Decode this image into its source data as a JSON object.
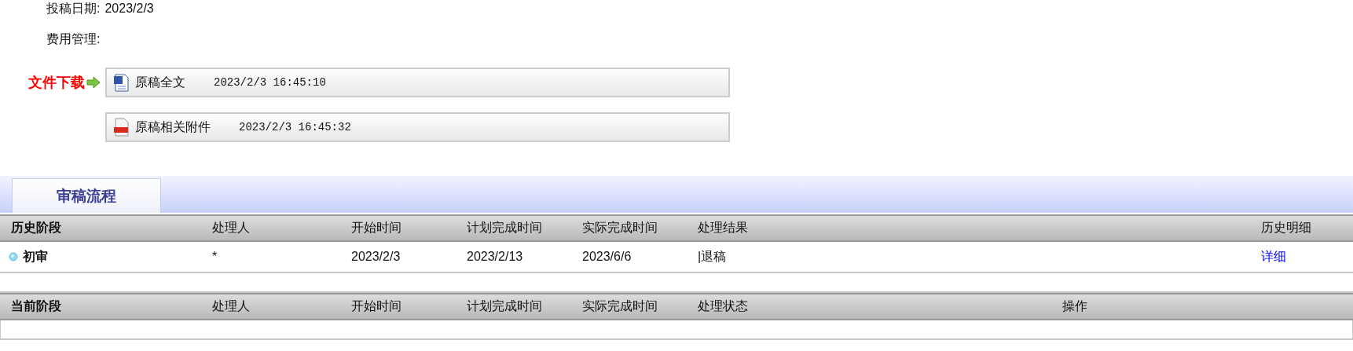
{
  "meta": [
    {
      "label": "投稿日期:",
      "value": "2023/2/3"
    },
    {
      "label": "费用管理:"
    }
  ],
  "downloads": {
    "label": "文件下载",
    "files": [
      {
        "kind": "word",
        "name": "原稿全文",
        "time": "2023/2/3 16:45:10"
      },
      {
        "kind": "pdf",
        "name": "原稿相关附件",
        "time": "2023/2/3 16:45:32"
      }
    ]
  },
  "tabs": [
    {
      "label": "审稿流程",
      "selected": true
    }
  ],
  "history": {
    "columns": [
      "历史阶段",
      "处理人",
      "开始时间",
      "计划完成时间",
      "实际完成时间",
      "处理结果",
      "历史明细"
    ],
    "rows": [
      {
        "stage": "初审",
        "handler": "*",
        "start": "2023/2/3",
        "planned": "2023/2/13",
        "actual": "2023/6/6",
        "result": "|退稿",
        "detail": "详细"
      }
    ]
  },
  "current": {
    "columns": [
      "当前阶段",
      "处理人",
      "开始时间",
      "计划完成时间",
      "实际完成时间",
      "处理状态",
      "操作"
    ]
  }
}
